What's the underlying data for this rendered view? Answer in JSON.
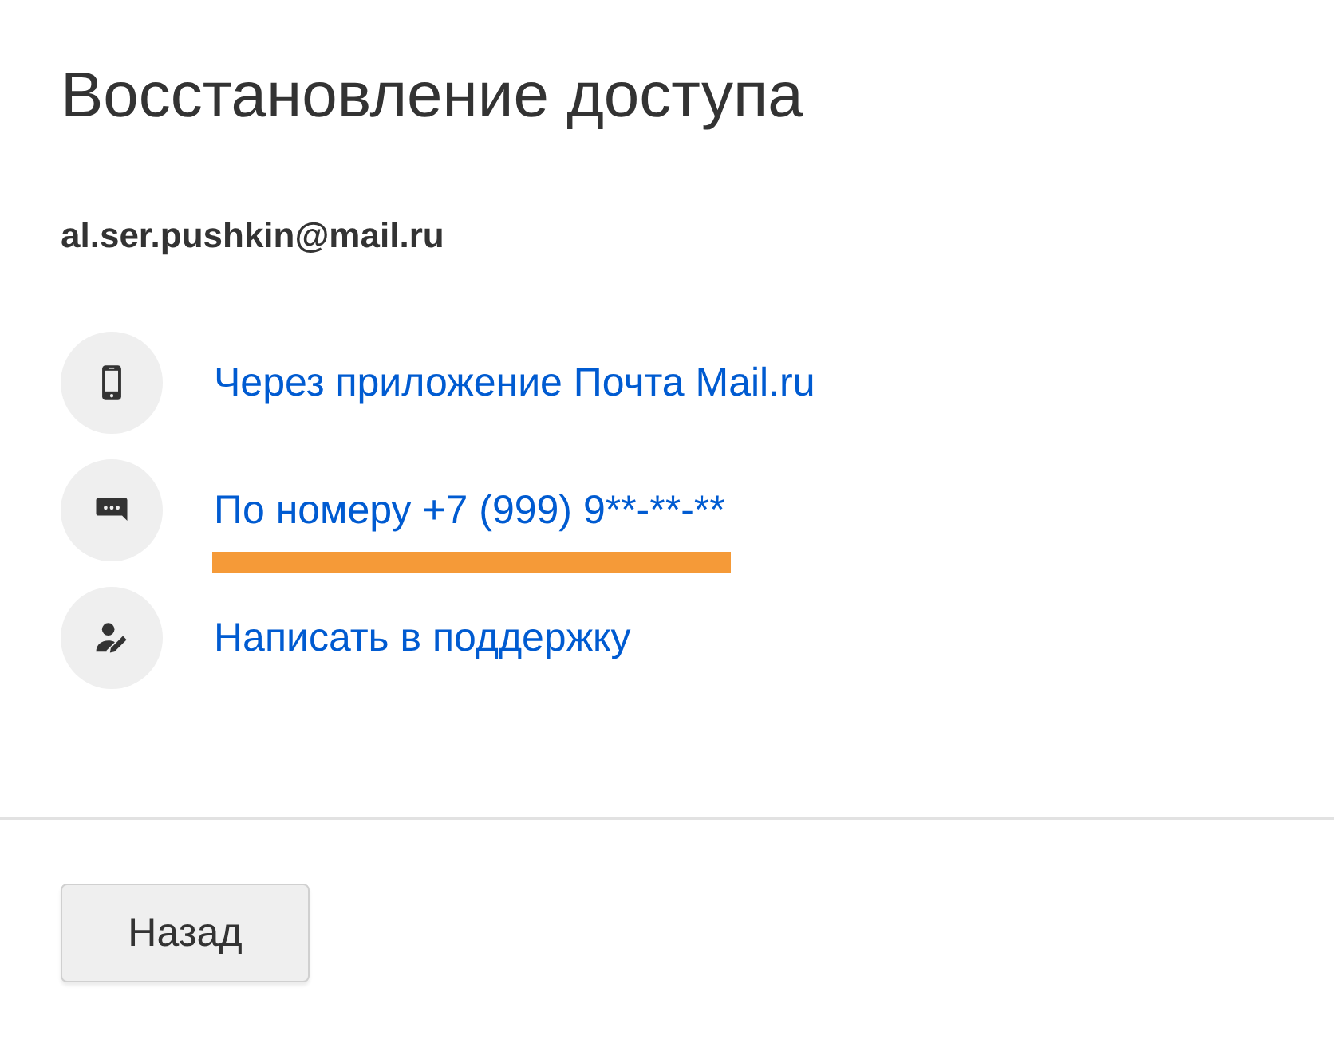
{
  "title": "Восстановление доступа",
  "email": "al.ser.pushkin@mail.ru",
  "options": [
    {
      "kind": "phone",
      "label": "Через приложение Почта Mail.ru",
      "highlighted": false
    },
    {
      "kind": "chat",
      "label": "По номеру +7 (999) 9**-**-**",
      "highlighted": true
    },
    {
      "kind": "support",
      "label": "Написать в поддержку",
      "highlighted": false
    }
  ],
  "buttons": [
    "Назад"
  ]
}
